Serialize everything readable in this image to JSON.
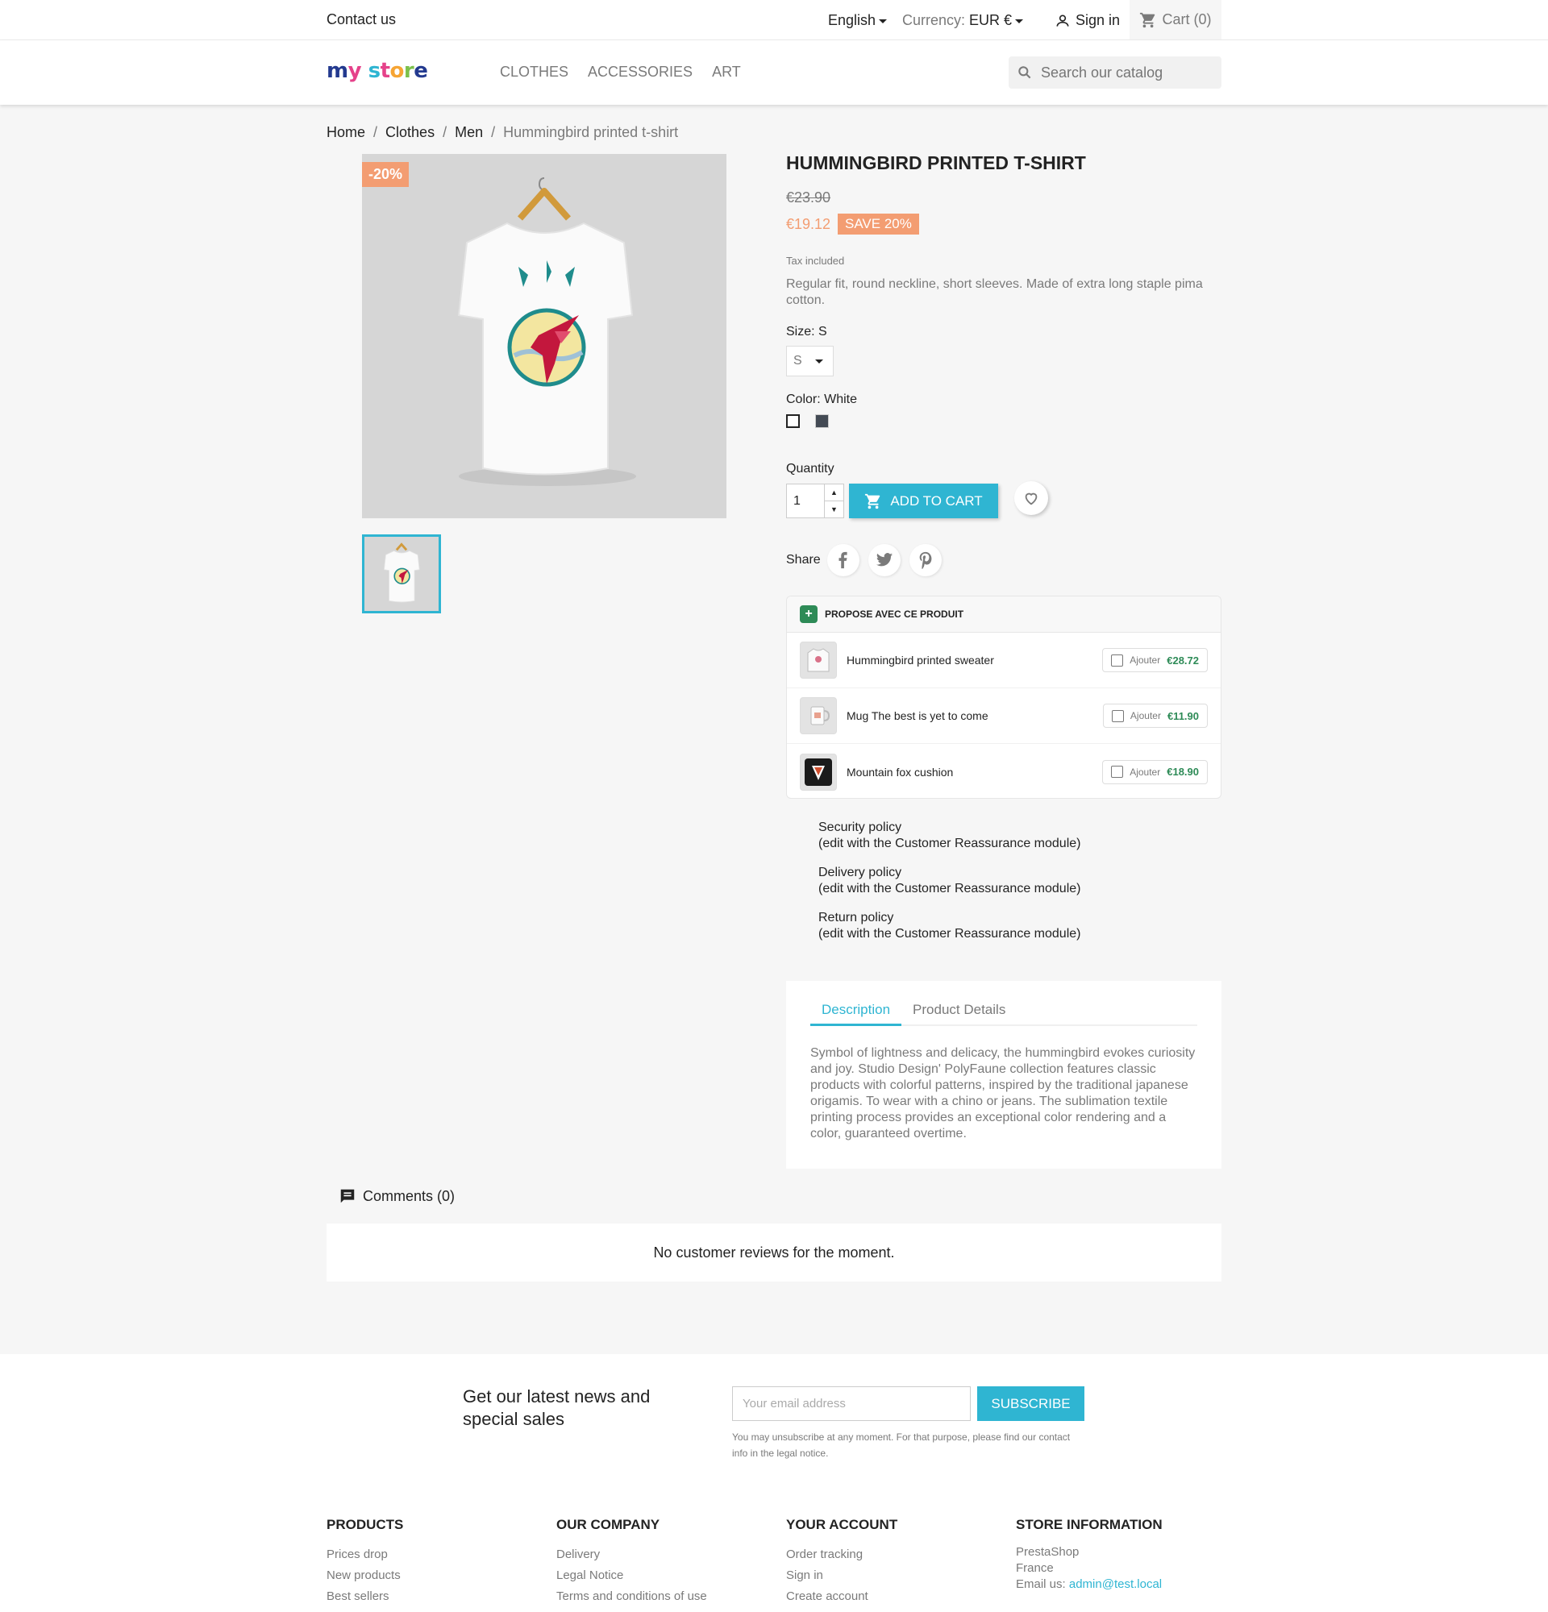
{
  "topbar": {
    "contact": "Contact us",
    "language": "English",
    "currency_label": "Currency:",
    "currency_value": "EUR €",
    "signin": "Sign in",
    "cart": "Cart (0)"
  },
  "header": {
    "menu": [
      "CLOTHES",
      "ACCESSORIES",
      "ART"
    ],
    "search_placeholder": "Search our catalog"
  },
  "breadcrumb": {
    "items": [
      "Home",
      "Clothes",
      "Men"
    ],
    "current": "Hummingbird printed t-shirt",
    "separator": "/"
  },
  "product": {
    "discount_flag": "-20%",
    "title": "HUMMINGBIRD PRINTED T-SHIRT",
    "old_price": "€23.90",
    "price": "€19.12",
    "save_badge": "SAVE 20%",
    "tax_note": "Tax included",
    "short_desc": "Regular fit, round neckline, short sleeves. Made of extra long staple pima cotton.",
    "size_label": "Size: S",
    "size_value": "S",
    "color_label": "Color: White",
    "colors": [
      "#ffffff",
      "#434a54"
    ],
    "quantity_label": "Quantity",
    "quantity": "1",
    "add_to_cart": "ADD TO CART",
    "share_label": "Share"
  },
  "propose": {
    "title": "PROPOSE AVEC CE PRODUIT",
    "add_label": "Ajouter",
    "items": [
      {
        "name": "Hummingbird printed sweater",
        "price": "€28.72"
      },
      {
        "name": "Mug The best is yet to come",
        "price": "€11.90"
      },
      {
        "name": "Mountain fox cushion",
        "price": "€18.90"
      }
    ]
  },
  "reassurance": [
    {
      "title": "Security policy",
      "note": "(edit with the Customer Reassurance module)"
    },
    {
      "title": "Delivery policy",
      "note": "(edit with the Customer Reassurance module)"
    },
    {
      "title": "Return policy",
      "note": "(edit with the Customer Reassurance module)"
    }
  ],
  "tabs": {
    "description": "Description",
    "details": "Product Details",
    "text": "Symbol of lightness and delicacy, the hummingbird evokes curiosity and joy. Studio Design' PolyFaune collection features classic products with colorful patterns, inspired by the traditional japanese origamis. To wear with a chino or jeans. The sublimation textile printing process provides an exceptional color rendering and a color, guaranteed overtime."
  },
  "comments": {
    "label": "Comments (0)",
    "empty": "No customer reviews for the moment."
  },
  "footer": {
    "newsletter": "Get our latest news and special sales",
    "email_placeholder": "Your email address",
    "subscribe": "SUBSCRIBE",
    "unsubscribe_note": "You may unsubscribe at any moment. For that purpose, please find our contact info in the legal notice.",
    "products": {
      "title": "PRODUCTS",
      "links": [
        "Prices drop",
        "New products",
        "Best sellers"
      ]
    },
    "company": {
      "title": "OUR COMPANY",
      "links": [
        "Delivery",
        "Legal Notice",
        "Terms and conditions of use"
      ]
    },
    "account": {
      "title": "YOUR ACCOUNT",
      "links": [
        "Order tracking",
        "Sign in",
        "Create account"
      ]
    },
    "store": {
      "title": "STORE INFORMATION",
      "name": "PrestaShop",
      "country": "France",
      "email_label": "Email us:",
      "email": "admin@test.local"
    }
  },
  "colors": {
    "accent": "#2fb5d2",
    "discount": "#f39d72",
    "green": "#2e8b57"
  }
}
